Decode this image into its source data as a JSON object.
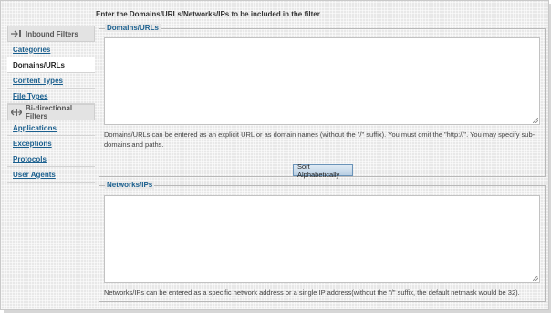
{
  "header": {
    "title": "Enter the Domains/URLs/Networks/IPs to be included in the filter"
  },
  "sidebar": {
    "inbound": {
      "label": "Inbound Filters",
      "items": [
        {
          "label": "Categories"
        },
        {
          "label": "Domains/URLs"
        },
        {
          "label": "Content Types"
        },
        {
          "label": "File Types"
        }
      ]
    },
    "bidirectional": {
      "label": "Bi-directional Filters",
      "items": [
        {
          "label": "Applications"
        },
        {
          "label": "Exceptions"
        },
        {
          "label": "Protocols"
        },
        {
          "label": "User Agents"
        }
      ]
    },
    "active_item": "Domains/URLs"
  },
  "domains_panel": {
    "legend": "Domains/URLs",
    "value": "",
    "help": "Domains/URLs can be entered as an explicit URL or as domain names (without the \"/\" suffix). You must omit the \"http://\". You may specify sub-domains and paths.",
    "sort_button": "Sort Alphabetically"
  },
  "networks_panel": {
    "legend": "Networks/IPs",
    "value": "",
    "help": "Networks/IPs can be entered as a specific network address or a single IP address(without the \"/\" suffix, the default netmask would be 32)."
  },
  "colors": {
    "link": "#1a5f8e",
    "border": "#b8b8b8",
    "button": "#b9cfe3"
  },
  "icons": {
    "inbound": "arrow-into-bar-icon",
    "bidirectional": "double-arrow-icon"
  }
}
